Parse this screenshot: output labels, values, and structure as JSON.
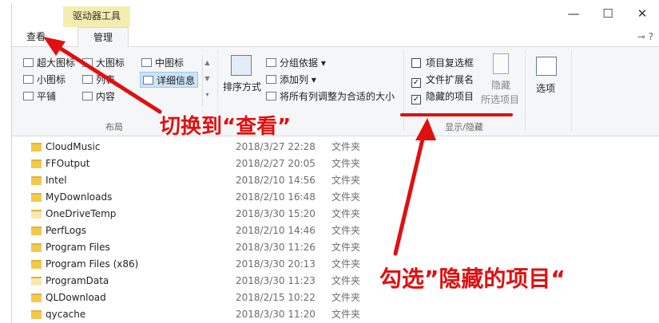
{
  "title_bar": {
    "context_tab": "驱动器工具",
    "minimize": "—",
    "maximize": "☐",
    "close": "✕"
  },
  "tabs": [
    {
      "label": "查看"
    },
    {
      "label": "管理"
    }
  ],
  "tab_right_icons": "⊸ ?",
  "ribbon": {
    "layout": {
      "label": "布局",
      "items": [
        {
          "label": "超大图标"
        },
        {
          "label": "大图标"
        },
        {
          "label": "中图标"
        },
        {
          "label": "小图标"
        },
        {
          "label": "列表"
        },
        {
          "label": "详细信息",
          "selected": true
        },
        {
          "label": "平铺"
        },
        {
          "label": "内容"
        }
      ]
    },
    "current_view": {
      "sort_label": "排序方式",
      "group_by": "分组依据",
      "add_column": "添加列",
      "fit_columns": "将所有列调整为合适的大小"
    },
    "show_hide": {
      "label": "显示/隐藏",
      "checkboxes": [
        {
          "label": "项目复选框",
          "checked": false
        },
        {
          "label": "文件扩展名",
          "checked": true
        },
        {
          "label": "隐藏的项目",
          "checked": true
        }
      ],
      "hide_button": "隐藏",
      "hide_sub": "所选项目",
      "options_button": "选项"
    }
  },
  "files": [
    {
      "name": "CloudMusic",
      "date": "2018/3/27 22:28",
      "type": "文件夹"
    },
    {
      "name": "FFOutput",
      "date": "2018/2/27 20:05",
      "type": "文件夹"
    },
    {
      "name": "Intel",
      "date": "2018/2/10 14:56",
      "type": "文件夹"
    },
    {
      "name": "MyDownloads",
      "date": "2018/2/10 16:48",
      "type": "文件夹"
    },
    {
      "name": "OneDriveTemp",
      "date": "2018/3/30 15:20",
      "type": "文件夹"
    },
    {
      "name": "PerfLogs",
      "date": "2018/2/10 14:46",
      "type": "文件夹"
    },
    {
      "name": "Program Files",
      "date": "2018/3/30 11:26",
      "type": "文件夹"
    },
    {
      "name": "Program Files (x86)",
      "date": "2018/3/30 20:13",
      "type": "文件夹"
    },
    {
      "name": "ProgramData",
      "date": "2018/3/30 11:23",
      "type": "文件夹"
    },
    {
      "name": "QLDownload",
      "date": "2018/2/15 10:22",
      "type": "文件夹"
    },
    {
      "name": "qycache",
      "date": "2018/3/30 11:20",
      "type": "文件夹"
    }
  ],
  "annotations": {
    "switch_to_view": "切换到“查看”",
    "check_hidden": "勾选”隐藏的项目“"
  },
  "colors": {
    "annotation": "#e01010",
    "context_tab": "#f5ecb0",
    "selected": "#cce4f7"
  }
}
